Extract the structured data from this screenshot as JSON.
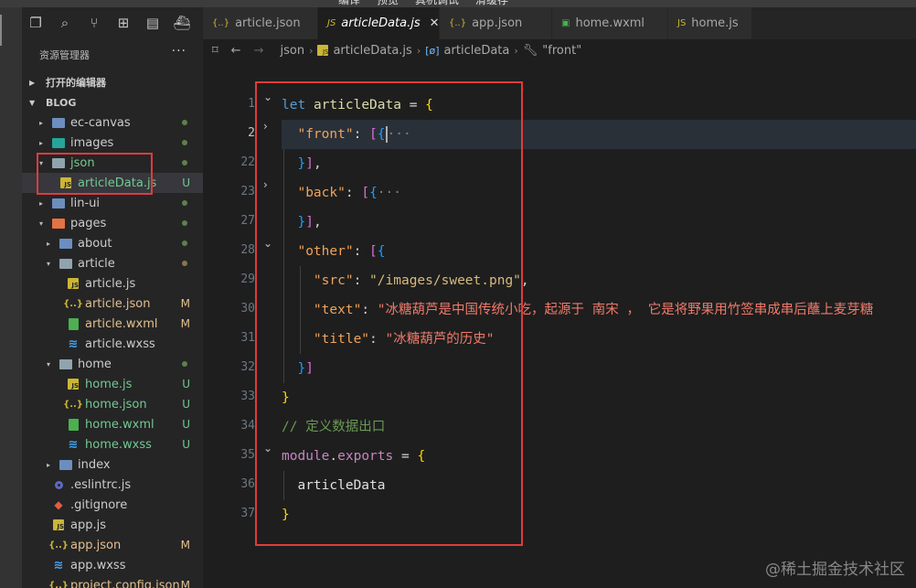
{
  "menubar": [
    "编译",
    "预览",
    "真机调试",
    "清缓存"
  ],
  "activity_icons": [
    "files-icon",
    "search-icon",
    "source-control-icon",
    "extensions-icon",
    "wechat-icon",
    "docker-icon"
  ],
  "explorer": {
    "title": "资源管理器",
    "more": "···",
    "open_editors": "打开的编辑器",
    "workspace": "BLOG"
  },
  "tree": [
    {
      "depth": 1,
      "kind": "folder",
      "label": "ec-canvas",
      "chev": "▸",
      "dot": true
    },
    {
      "depth": 1,
      "kind": "folder",
      "label": "images",
      "chev": "▸",
      "dot": true,
      "icon": "teal"
    },
    {
      "depth": 1,
      "kind": "folder-open",
      "label": "json",
      "chev": "▾",
      "dot": true,
      "labelStyle": "U"
    },
    {
      "depth": 2,
      "kind": "js",
      "label": "articleData.js",
      "status": "U",
      "selected": true,
      "labelStyle": "U"
    },
    {
      "depth": 1,
      "kind": "folder",
      "label": "lin-ui",
      "chev": "▸",
      "dot": true
    },
    {
      "depth": 1,
      "kind": "folder-open",
      "label": "pages",
      "chev": "▾",
      "dot": true,
      "icon": "orange"
    },
    {
      "depth": 2,
      "kind": "folder",
      "label": "about",
      "chev": "▸",
      "dot": true
    },
    {
      "depth": 2,
      "kind": "folder-open",
      "label": "article",
      "chev": "▾",
      "dot": true,
      "dotColor": "M"
    },
    {
      "depth": 3,
      "kind": "js",
      "label": "article.js"
    },
    {
      "depth": 3,
      "kind": "json",
      "label": "article.json",
      "status": "M"
    },
    {
      "depth": 3,
      "kind": "wxml",
      "label": "article.wxml",
      "status": "M"
    },
    {
      "depth": 3,
      "kind": "wxss",
      "label": "article.wxss"
    },
    {
      "depth": 2,
      "kind": "folder-open",
      "label": "home",
      "chev": "▾",
      "dot": true
    },
    {
      "depth": 3,
      "kind": "js",
      "label": "home.js",
      "status": "U",
      "labelStyle": "U"
    },
    {
      "depth": 3,
      "kind": "json",
      "label": "home.json",
      "status": "U",
      "labelStyle": "U"
    },
    {
      "depth": 3,
      "kind": "wxml",
      "label": "home.wxml",
      "status": "U",
      "labelStyle": "U"
    },
    {
      "depth": 3,
      "kind": "wxss",
      "label": "home.wxss",
      "status": "U",
      "labelStyle": "U"
    },
    {
      "depth": 2,
      "kind": "folder",
      "label": "index",
      "chev": "▸"
    },
    {
      "depth": 1,
      "kind": "dotfile",
      "label": ".eslintrc.js"
    },
    {
      "depth": 1,
      "kind": "git",
      "label": ".gitignore"
    },
    {
      "depth": 1,
      "kind": "js",
      "label": "app.js"
    },
    {
      "depth": 1,
      "kind": "json",
      "label": "app.json",
      "status": "M"
    },
    {
      "depth": 1,
      "kind": "wxss",
      "label": "app.wxss"
    },
    {
      "depth": 1,
      "kind": "json",
      "label": "project.config.json",
      "status": "M"
    }
  ],
  "tabs": [
    {
      "icon": "{..}",
      "label": "article.json",
      "iconColor": "#cbb635"
    },
    {
      "icon": "JS",
      "label": "articleData.js",
      "active": true,
      "close": "✕",
      "iconColor": "#cbb635"
    },
    {
      "icon": "{..}",
      "label": "app.json",
      "iconColor": "#cbb635"
    },
    {
      "icon": "▣",
      "label": "home.wxml",
      "iconColor": "#4caf50"
    },
    {
      "icon": "JS",
      "label": "home.js",
      "iconColor": "#cbb635"
    }
  ],
  "breadcrumb": [
    "json",
    "articleData.js",
    "articleData",
    "\"front\""
  ],
  "editor": {
    "line_numbers": [
      "1",
      "2",
      "22",
      "23",
      "27",
      "28",
      "29",
      "30",
      "31",
      "32",
      "33",
      "34",
      "35",
      "36",
      "37"
    ],
    "current_line": "2",
    "comment": "// 定义数据出口",
    "strings": {
      "front": "\"front\"",
      "back": "\"back\"",
      "other": "\"other\"",
      "src": "\"src\"",
      "src_val": "\"/images/sweet.png\"",
      "text": "\"text\"",
      "text_val": "\"冰糖葫芦是中国传统小吃，起源于 南宋 ， 它是将野果用竹签串成串后蘸上麦芽糖",
      "title": "\"title\"",
      "title_val": "\"冰糖葫芦的历史\""
    }
  },
  "watermark": "@稀土掘金技术社区"
}
